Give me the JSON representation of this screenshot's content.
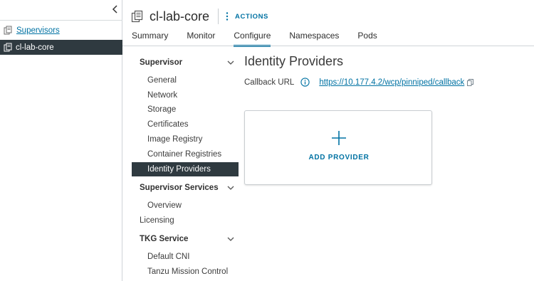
{
  "navigator": {
    "parent_label": "Supervisors",
    "selected_label": "cl-lab-core"
  },
  "header": {
    "title": "cl-lab-core",
    "actions_label": "ACTIONS"
  },
  "tabs": [
    {
      "label": "Summary"
    },
    {
      "label": "Monitor"
    },
    {
      "label": "Configure",
      "active": true
    },
    {
      "label": "Namespaces"
    },
    {
      "label": "Pods"
    }
  ],
  "config_nav": {
    "supervisor": {
      "label": "Supervisor",
      "items": [
        "General",
        "Network",
        "Storage",
        "Certificates",
        "Image Registry",
        "Container Registries",
        "Identity Providers"
      ]
    },
    "supervisor_services": {
      "label": "Supervisor Services",
      "items": [
        "Overview"
      ]
    },
    "licensing": "Licensing",
    "tkg_service": {
      "label": "TKG Service",
      "items": [
        "Default CNI",
        "Tanzu Mission Control"
      ]
    },
    "selected": "Identity Providers"
  },
  "content": {
    "title": "Identity Providers",
    "callback_label": "Callback URL",
    "callback_url": "https://10.177.4.2/wcp/pinniped/callback",
    "add_provider_label": "ADD PROVIDER"
  },
  "colors": {
    "accent": "#0072a3",
    "selected_bg": "#2f3a40"
  },
  "icons": {
    "collapse": "chevron-left-icon",
    "supervisor": "supervisor-cluster-icon",
    "info": "info-circle-icon",
    "copy": "copy-icon",
    "add": "plus-icon",
    "actions": "kebab-vertical-icon"
  }
}
